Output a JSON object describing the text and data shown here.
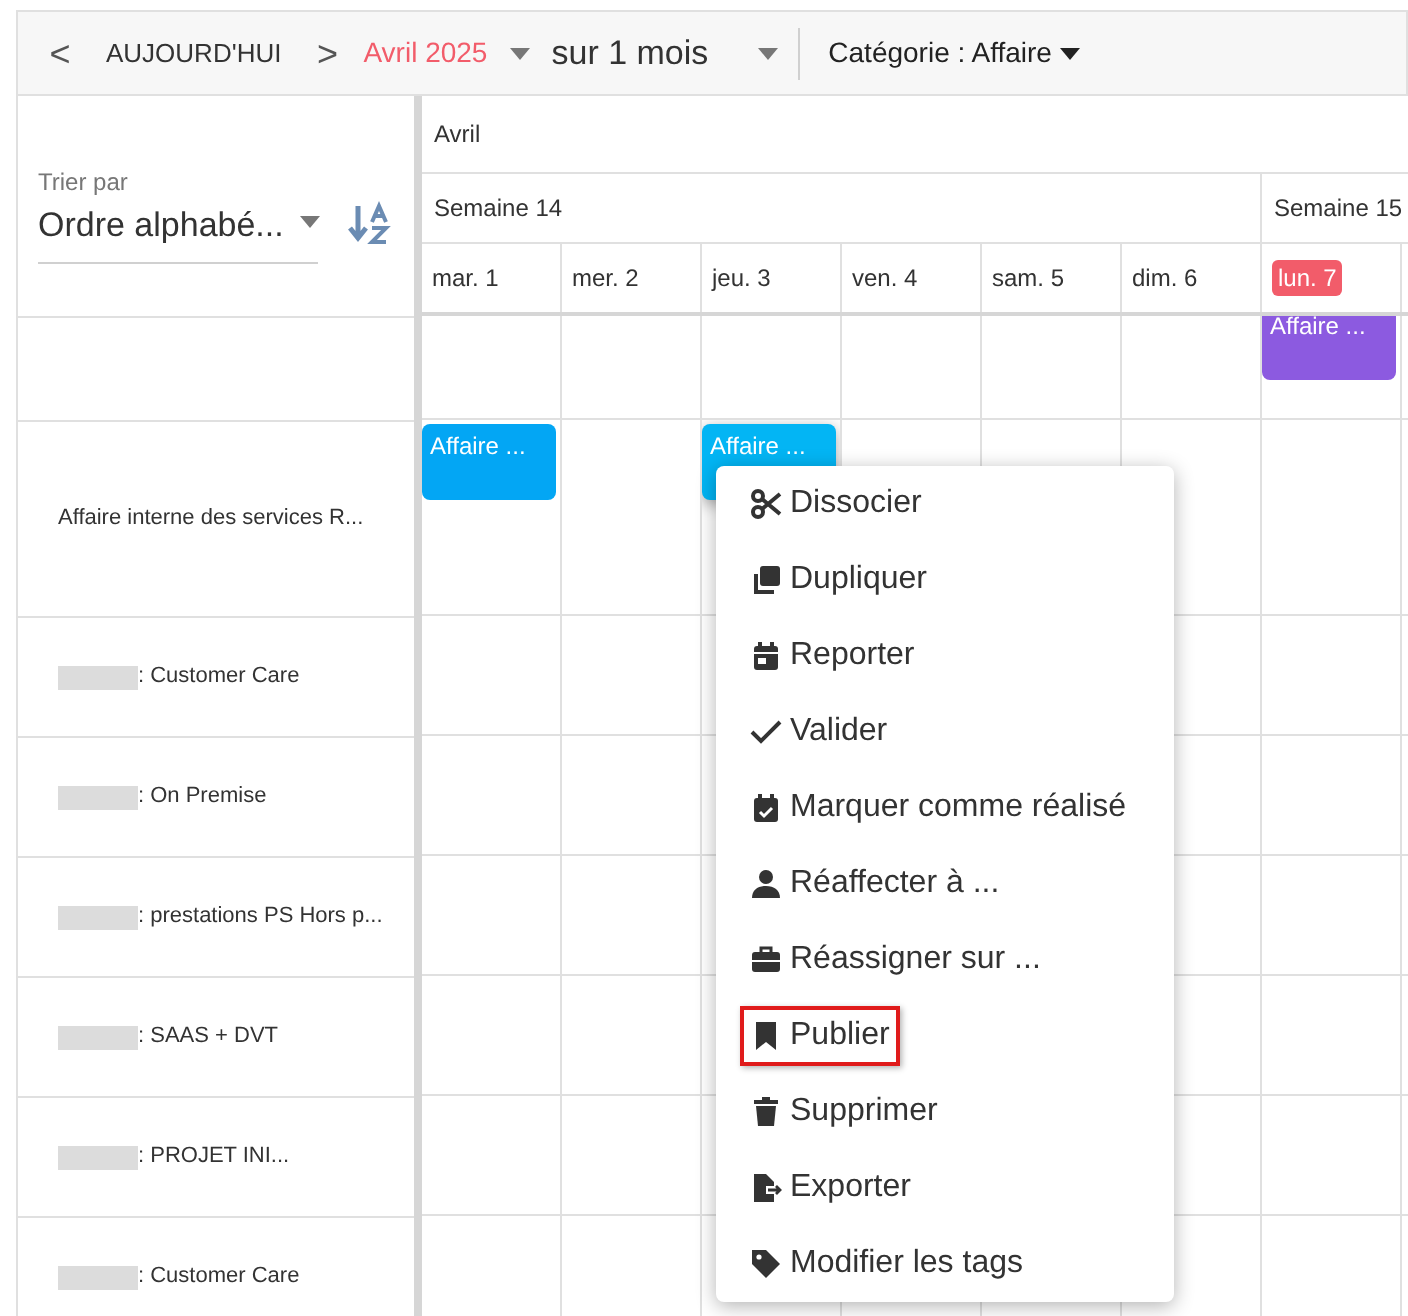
{
  "toolbar": {
    "previous": "<",
    "today": "AUJOURD'HUI",
    "next": ">",
    "month": "Avril 2025",
    "range": "sur 1 mois",
    "category": "Catégorie : Affaire"
  },
  "sort": {
    "label": "Trier par",
    "value": "Ordre alphabé..."
  },
  "header": {
    "month": "Avril",
    "weeks": [
      {
        "label": "Semaine 14",
        "days": [
          {
            "label": "mar. 1",
            "today": false
          },
          {
            "label": "mer. 2",
            "today": false
          },
          {
            "label": "jeu. 3",
            "today": false
          },
          {
            "label": "ven. 4",
            "today": false
          },
          {
            "label": "sam. 5",
            "today": false
          },
          {
            "label": "dim. 6",
            "today": false
          }
        ]
      },
      {
        "label": "Semaine 15",
        "days": [
          {
            "label": "lun. 7",
            "today": true
          }
        ]
      }
    ]
  },
  "rows": [
    {
      "label": "",
      "redacted": false,
      "cells": [
        {},
        {},
        {},
        {},
        {},
        {},
        {
          "event": {
            "label": "Affaire ...",
            "color": "#8c5ae0",
            "selected": false
          }
        }
      ]
    },
    {
      "label": "Affaire interne des services R...",
      "redacted": false,
      "cells": [
        {
          "event": {
            "label": "Affaire ...",
            "color": "#03a6f4",
            "selected": false
          }
        },
        {},
        {
          "event": {
            "label": "Affaire ...",
            "color": "#03b5f4",
            "selected": true
          }
        },
        {},
        {},
        {},
        {}
      ]
    },
    {
      "label": ": Customer Care",
      "redacted": true,
      "cells": [
        {},
        {},
        {},
        {},
        {},
        {},
        {}
      ]
    },
    {
      "label": ": On Premise",
      "redacted": true,
      "cells": [
        {},
        {},
        {},
        {},
        {},
        {},
        {}
      ]
    },
    {
      "label": ": prestations PS Hors p...",
      "redacted": true,
      "cells": [
        {},
        {},
        {},
        {},
        {},
        {},
        {}
      ]
    },
    {
      "label": ": SAAS + DVT",
      "redacted": true,
      "cells": [
        {},
        {},
        {},
        {},
        {},
        {},
        {}
      ]
    },
    {
      "label": ": PROJET INI...",
      "redacted": true,
      "cells": [
        {},
        {},
        {},
        {},
        {},
        {},
        {}
      ]
    },
    {
      "label": ": Customer Care",
      "redacted": true,
      "cells": [
        {},
        {},
        {},
        {},
        {},
        {},
        {}
      ]
    }
  ],
  "context_menu": [
    {
      "kind": "scissors",
      "label": "Dissocier",
      "highlighted": false
    },
    {
      "kind": "copy",
      "label": "Dupliquer",
      "highlighted": false
    },
    {
      "kind": "calendar",
      "label": "Reporter",
      "highlighted": false
    },
    {
      "kind": "check",
      "label": "Valider",
      "highlighted": false
    },
    {
      "kind": "calendar-check",
      "label": "Marquer comme réalisé",
      "highlighted": false
    },
    {
      "kind": "user",
      "label": "Réaffecter à ...",
      "highlighted": false
    },
    {
      "kind": "briefcase",
      "label": "Réassigner sur ...",
      "highlighted": false
    },
    {
      "kind": "bookmark",
      "label": "Publier",
      "highlighted": true
    },
    {
      "kind": "trash",
      "label": "Supprimer",
      "highlighted": false
    },
    {
      "kind": "export",
      "label": "Exporter",
      "highlighted": false
    },
    {
      "kind": "tag",
      "label": "Modifier les tags",
      "highlighted": false
    }
  ]
}
